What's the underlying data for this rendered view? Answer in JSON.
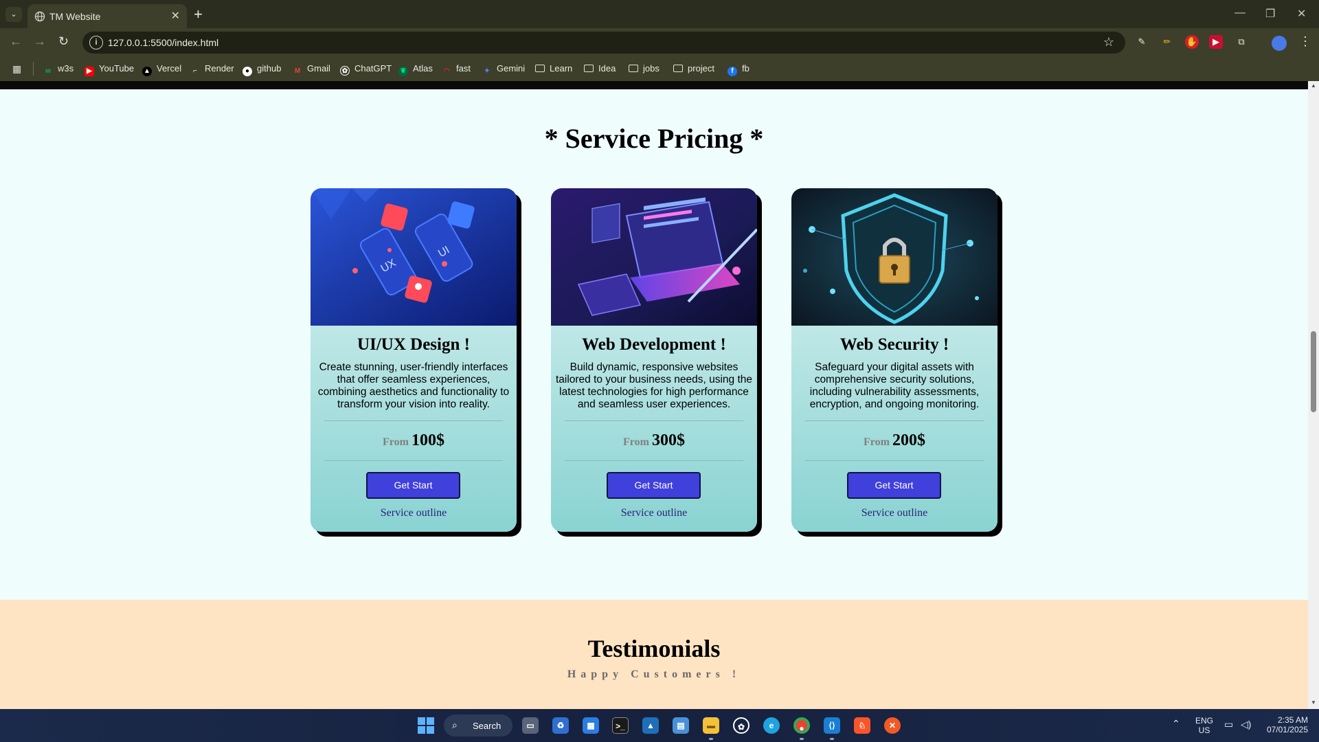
{
  "browser": {
    "tab_title": "TM Website",
    "url": "127.0.0.1:5500/index.html",
    "bookmarks": [
      {
        "label": "w3s",
        "icon": "w3s-icon",
        "color": "#04aa6d"
      },
      {
        "label": "YouTube",
        "icon": "youtube-icon",
        "color": "#ff0000"
      },
      {
        "label": "Vercel",
        "icon": "vercel-icon",
        "color": "#000000"
      },
      {
        "label": "Render",
        "icon": "render-icon",
        "color": "#000000"
      },
      {
        "label": "github",
        "icon": "github-icon",
        "color": "#ffffff"
      },
      {
        "label": "Gmail",
        "icon": "gmail-icon",
        "color": "#ea4335"
      },
      {
        "label": "ChatGPT",
        "icon": "chatgpt-icon",
        "color": "#ffffff"
      },
      {
        "label": "Atlas",
        "icon": "atlas-icon",
        "color": "#00684a"
      },
      {
        "label": "fast",
        "icon": "fast-icon",
        "color": "#e1251b"
      },
      {
        "label": "Gemini",
        "icon": "gemini-icon",
        "color": "#4b8bf5"
      },
      {
        "label": "Learn",
        "icon": "folder-icon"
      },
      {
        "label": "Idea",
        "icon": "folder-icon"
      },
      {
        "label": "jobs",
        "icon": "folder-icon"
      },
      {
        "label": "project",
        "icon": "folder-icon"
      },
      {
        "label": "fb",
        "icon": "facebook-icon",
        "color": "#1877f2"
      }
    ]
  },
  "pricing": {
    "title": "* Service Pricing *",
    "cards": [
      {
        "title": "UI/UX Design !",
        "description": "Create stunning, user-friendly interfaces that offer seamless experiences, combining aesthetics and functionality to transform your vision into reality.",
        "price_prefix": "From",
        "price": "100$",
        "button": "Get Start",
        "link": "Service outline",
        "image": "ui-ux-illustration"
      },
      {
        "title": "Web Development !",
        "description": "Build dynamic, responsive websites tailored to your business needs, using the latest technologies for high performance and seamless user experiences.",
        "price_prefix": "From",
        "price": "300$",
        "button": "Get Start",
        "link": "Service outline",
        "image": "web-development-illustration"
      },
      {
        "title": "Web Security !",
        "description": "Safeguard your digital assets with comprehensive security solutions, including vulnerability assessments, encryption, and ongoing monitoring.",
        "price_prefix": "From",
        "price": "200$",
        "button": "Get Start",
        "link": "Service outline",
        "image": "web-security-illustration"
      }
    ]
  },
  "testimonials": {
    "title": "Testimonials",
    "subtitle": "Happy Customers !"
  },
  "taskbar": {
    "search_label": "Search",
    "language": "ENG",
    "region": "US",
    "time": "2:35 AM",
    "date": "07/01/2025"
  },
  "colors": {
    "button": "#4040dc",
    "pricing_bg": "#f0fdfd",
    "testimonials_bg": "#ffe4c4",
    "card_gradient_end": "#89d3d2"
  }
}
